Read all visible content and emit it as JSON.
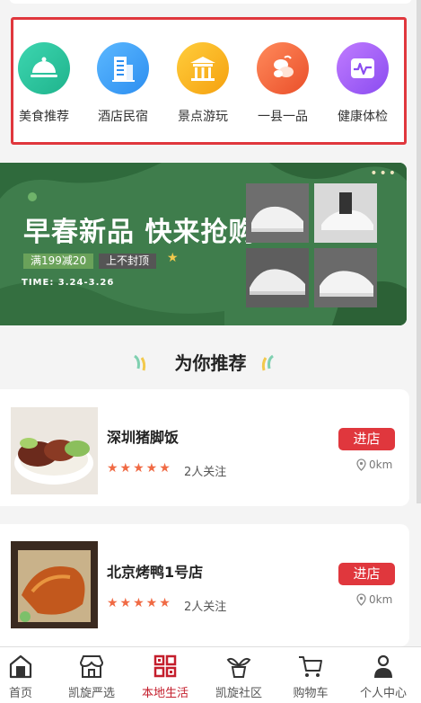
{
  "categories": [
    {
      "label": "美食推荐",
      "icon": "cloche-icon",
      "color_from": "#3dd6b0",
      "color_to": "#1fb38c"
    },
    {
      "label": "酒店民宿",
      "icon": "hotel-building-icon",
      "color_from": "#5bb8ff",
      "color_to": "#2d8ef0"
    },
    {
      "label": "景点游玩",
      "icon": "temple-gate-icon",
      "color_from": "#ffcd3c",
      "color_to": "#f5a10f"
    },
    {
      "label": "一县一品",
      "icon": "produce-icon",
      "color_from": "#ff8a5b",
      "color_to": "#ea4f2a"
    },
    {
      "label": "健康体检",
      "icon": "health-monitor-icon",
      "color_from": "#c07bff",
      "color_to": "#8a4cf0"
    }
  ],
  "banner": {
    "title": "早春新品 快来抢购",
    "badge_discount": "满199减20",
    "badge_cap": "上不封顶",
    "time": "TIME: 3.24-3.26",
    "dots": "•••"
  },
  "section": {
    "title": "为你推荐"
  },
  "shops": [
    {
      "name": "深圳猪脚饭",
      "stars": "★★★★★",
      "follow": "2人关注",
      "enter": "进店",
      "distance": "0km"
    },
    {
      "name": "北京烤鸭1号店",
      "stars": "★★★★★",
      "follow": "2人关注",
      "enter": "进店",
      "distance": "0km"
    }
  ],
  "tabs": [
    {
      "label": "首页",
      "icon": "home-icon"
    },
    {
      "label": "凯旋严选",
      "icon": "storefront-icon"
    },
    {
      "label": "本地生活",
      "icon": "grid-icon",
      "active": true
    },
    {
      "label": "凯旋社区",
      "icon": "plant-pot-icon"
    },
    {
      "label": "购物车",
      "icon": "cart-icon"
    },
    {
      "label": "个人中心",
      "icon": "user-icon"
    }
  ],
  "colors": {
    "accent": "#e0373d",
    "active_tab": "#c41e2c",
    "star": "#f06a44",
    "banner_green": "#3d7a4a"
  }
}
